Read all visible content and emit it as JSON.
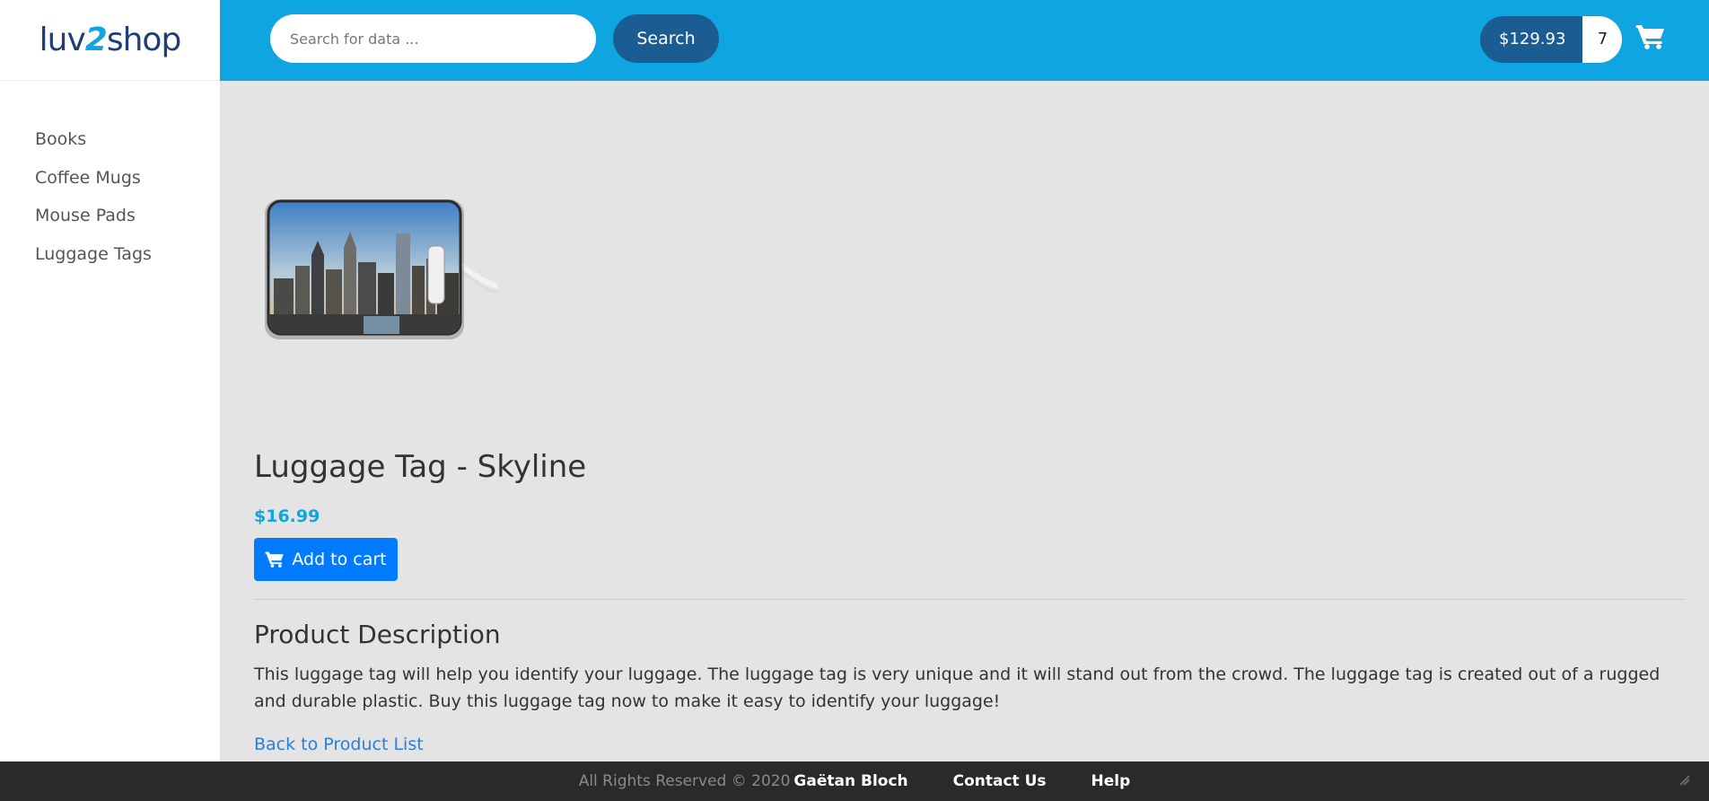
{
  "brand": {
    "logo_left": "luv",
    "logo_mid": "2",
    "logo_right": "shop"
  },
  "sidebar": {
    "items": [
      {
        "label": "Books"
      },
      {
        "label": "Coffee Mugs"
      },
      {
        "label": "Mouse Pads"
      },
      {
        "label": "Luggage Tags"
      }
    ]
  },
  "header": {
    "search": {
      "placeholder": "Search for data ...",
      "value": ""
    },
    "search_button": "Search",
    "cart": {
      "total": "$129.93",
      "quantity": "7",
      "icon": "shopping-cart-icon"
    }
  },
  "product": {
    "image": "luggage-tag-skyline-image",
    "name": "Luggage Tag - Skyline",
    "price": "$16.99",
    "add_to_cart": "Add to cart",
    "description_heading": "Product Description",
    "description": "This luggage tag will help you identify your luggage. The luggage tag is very unique and it will stand out from the crowd. The luggage tag is created out of a rugged and durable plastic. Buy this luggage tag now to make it easy to identify your luggage!",
    "back_link": "Back to Product List"
  },
  "footer": {
    "rights": "All Rights Reserved © 2020",
    "author": "Gaëtan Bloch",
    "links": [
      "Contact Us",
      "Help"
    ]
  },
  "colors": {
    "header_bg": "#0ea5e1",
    "dark_blue": "#1b5c93",
    "price": "#0ea5e1",
    "button": "#007bff",
    "content_bg": "#e4e4e4",
    "footer_bg": "#2a2a2a"
  }
}
